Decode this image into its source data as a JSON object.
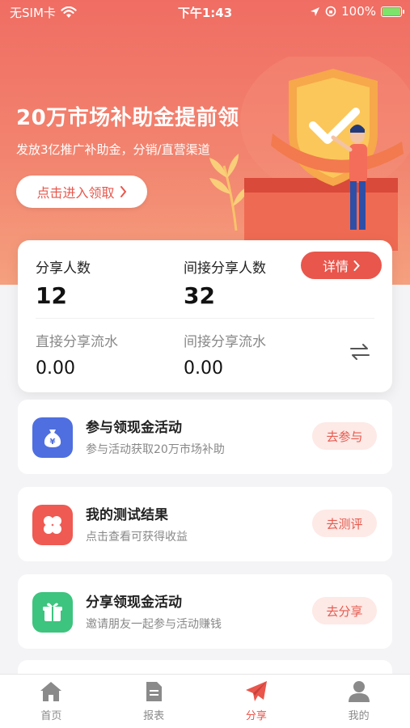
{
  "status_bar": {
    "carrier": "无SIM卡",
    "time": "下午1:43",
    "battery": "100%",
    "battery_level_percent": 100
  },
  "banner": {
    "title": "20万市场补助金提前领",
    "subtitle": "发放3亿推广补助金，分销/直营渠道",
    "button_label": "点击进入领取"
  },
  "stats": {
    "share_count_label": "分享人数",
    "share_count_value": "12",
    "indirect_share_label": "间接分享人数",
    "indirect_share_value": "32",
    "detail_button": "详情",
    "direct_flow_label": "直接分享流水",
    "direct_flow_value": "0.00",
    "indirect_flow_label": "间接分享流水",
    "indirect_flow_value": "0.00"
  },
  "activities": [
    {
      "title": "参与领现金活动",
      "desc": "参与活动获取20万市场补助",
      "action": "去参与",
      "icon": "money-bag-icon",
      "color": "#4f6fe0"
    },
    {
      "title": "我的测试结果",
      "desc": "点击查看可获得收益",
      "action": "去测评",
      "icon": "clover-icon",
      "color": "#ef5a52"
    },
    {
      "title": "分享领现金活动",
      "desc": "邀请朋友一起参与活动赚钱",
      "action": "去分享",
      "icon": "gift-icon",
      "color": "#3dc47e"
    }
  ],
  "tab_bar": {
    "items": [
      {
        "label": "首页",
        "icon": "home-icon"
      },
      {
        "label": "报表",
        "icon": "report-icon"
      },
      {
        "label": "分享",
        "icon": "paper-plane-icon",
        "active": true
      },
      {
        "label": "我的",
        "icon": "user-icon"
      }
    ]
  },
  "colors": {
    "accent": "#e9564c",
    "banner_gradient_top": "#f06d63",
    "banner_gradient_bottom": "#f5a07e"
  }
}
